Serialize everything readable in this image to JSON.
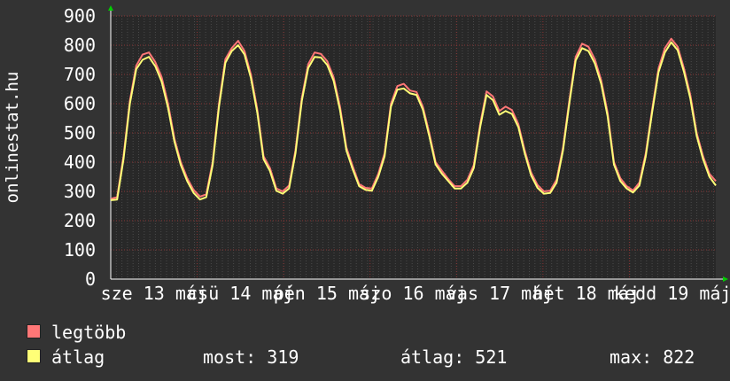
{
  "chart_data": {
    "type": "line",
    "ylabel": "onlinestat.hu",
    "ylim": [
      0,
      900
    ],
    "y_ticks": [
      0,
      100,
      200,
      300,
      400,
      500,
      600,
      700,
      800,
      900
    ],
    "x_tick_labels": [
      "sze 13 máj",
      "csü 14 máj",
      "pén 15 máj",
      "szo 16 máj",
      "vas 17 máj",
      "hét 18 máj",
      "kedd 19 máj"
    ],
    "x_tick_labels_visible": [
      "sze 13 máj",
      "14 máj",
      "15 máj",
      "szo 16 máj",
      "17 máj",
      "18 máj",
      "19 máj"
    ],
    "grid": true,
    "series": [
      {
        "name": "legtöbb",
        "color": "#ff7777",
        "values": [
          275,
          280,
          420,
          610,
          730,
          768,
          775,
          742,
          690,
          600,
          480,
          400,
          345,
          305,
          282,
          290,
          400,
          600,
          752,
          790,
          815,
          780,
          700,
          580,
          420,
          380,
          310,
          300,
          320,
          440,
          620,
          735,
          775,
          770,
          745,
          690,
          590,
          450,
          385,
          325,
          312,
          310,
          360,
          430,
          600,
          660,
          668,
          645,
          640,
          590,
          500,
          400,
          370,
          342,
          318,
          318,
          340,
          390,
          530,
          642,
          625,
          575,
          590,
          578,
          530,
          440,
          365,
          322,
          300,
          302,
          340,
          450,
          610,
          760,
          805,
          795,
          752,
          680,
          570,
          400,
          345,
          318,
          303,
          330,
          430,
          580,
          720,
          790,
          822,
          795,
          720,
          630,
          500,
          420,
          360,
          335
        ]
      },
      {
        "name": "átlag",
        "color": "#ffff77",
        "values": [
          270,
          272,
          410,
          600,
          718,
          750,
          760,
          728,
          675,
          585,
          470,
          390,
          335,
          295,
          272,
          280,
          390,
          590,
          740,
          780,
          800,
          768,
          688,
          570,
          410,
          370,
          302,
          292,
          310,
          430,
          610,
          722,
          760,
          758,
          732,
          678,
          578,
          440,
          375,
          318,
          305,
          302,
          350,
          420,
          590,
          648,
          652,
          635,
          630,
          580,
          490,
          392,
          360,
          335,
          310,
          310,
          330,
          380,
          520,
          630,
          612,
          562,
          575,
          565,
          520,
          430,
          355,
          312,
          292,
          295,
          330,
          440,
          600,
          748,
          790,
          780,
          738,
          668,
          558,
          392,
          335,
          310,
          296,
          320,
          420,
          570,
          708,
          775,
          810,
          783,
          708,
          618,
          490,
          410,
          350,
          320
        ]
      }
    ]
  },
  "legend": {
    "items": [
      {
        "label": "legtöbb",
        "color": "#ff7777"
      },
      {
        "label": "átlag",
        "color": "#ffff77"
      }
    ]
  },
  "stats": {
    "most": "most: 319",
    "atlag": "átlag: 521",
    "max": "max: 822"
  }
}
